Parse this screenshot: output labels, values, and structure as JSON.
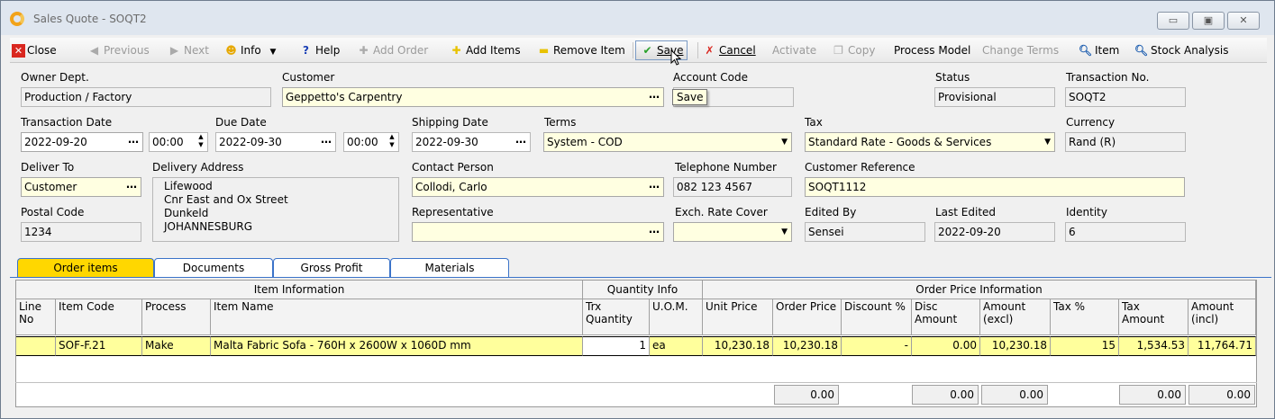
{
  "window": {
    "title": "Sales Quote - SOQT2",
    "minimize": "▭",
    "maximize": "▣",
    "close": "✕"
  },
  "toolbar": {
    "close": "Close",
    "previous": "Previous",
    "next": "Next",
    "info": "Info",
    "help": "Help",
    "add_order": "Add Order",
    "add_items": "Add Items",
    "remove_item": "Remove Item",
    "save": "Save",
    "cancel": "Cancel",
    "activate": "Activate",
    "copy": "Copy",
    "process_model": "Process Model",
    "change_terms": "Change Terms",
    "item": "Item",
    "stock_analysis": "Stock Analysis"
  },
  "tooltip": "Save",
  "form": {
    "owner_dept": {
      "label": "Owner Dept.",
      "value": "Production / Factory"
    },
    "customer": {
      "label": "Customer",
      "value": "Geppetto's Carpentry"
    },
    "account_code": {
      "label": "Account Code",
      "value": ""
    },
    "status": {
      "label": "Status",
      "value": "Provisional"
    },
    "transaction_no": {
      "label": "Transaction No.",
      "value": "SOQT2"
    },
    "transaction_date": {
      "label": "Transaction Date",
      "value": "2022-09-20",
      "time": "00:00"
    },
    "due_date": {
      "label": "Due Date",
      "value": "2022-09-30",
      "time": "00:00"
    },
    "shipping_date": {
      "label": "Shipping Date",
      "value": "2022-09-30"
    },
    "terms": {
      "label": "Terms",
      "value": "System - COD"
    },
    "tax": {
      "label": "Tax",
      "value": "Standard Rate - Goods & Services"
    },
    "currency": {
      "label": "Currency",
      "value": "Rand (R)"
    },
    "deliver_to": {
      "label": "Deliver To",
      "value": "Customer"
    },
    "delivery_address": {
      "label": "Delivery Address",
      "lines": [
        "Lifewood",
        "Cnr East and Ox Street",
        "Dunkeld",
        "JOHANNESBURG"
      ]
    },
    "contact_person": {
      "label": "Contact Person",
      "value": "Collodi, Carlo"
    },
    "telephone": {
      "label": "Telephone Number",
      "value": "082 123 4567"
    },
    "customer_reference": {
      "label": "Customer Reference",
      "value": "SOQT1112"
    },
    "postal_code": {
      "label": "Postal Code",
      "value": "1234"
    },
    "representative": {
      "label": "Representative",
      "value": ""
    },
    "exch_rate_cover": {
      "label": "Exch. Rate Cover",
      "value": ""
    },
    "edited_by": {
      "label": "Edited By",
      "value": "Sensei"
    },
    "last_edited": {
      "label": "Last Edited",
      "value": "2022-09-20"
    },
    "identity": {
      "label": "Identity",
      "value": "6"
    }
  },
  "tabs": [
    "Order items",
    "Documents",
    "Gross Profit",
    "Materials"
  ],
  "grid": {
    "groups": {
      "item_info": "Item Information",
      "qty_info": "Quantity Info",
      "price_info": "Order Price Information"
    },
    "columns": {
      "line_no": "Line\nNo",
      "item_code": "Item Code",
      "process": "Process",
      "item_name": "Item Name",
      "trx_qty": "Trx\nQuantity",
      "uom": "U.O.M.",
      "unit_price": "Unit Price",
      "order_price": "Order Price",
      "discount_pct": "Discount %",
      "disc_amount": "Disc\nAmount",
      "amount_excl": "Amount\n(excl)",
      "tax_pct": "Tax %",
      "tax_amount": "Tax\nAmount",
      "amount_incl": "Amount\n(incl)"
    },
    "rows": [
      {
        "line_no": "",
        "item_code": "SOF-F.21",
        "process": "Make",
        "item_name": "Malta Fabric Sofa - 760H x 2600W x 1060D mm",
        "trx_qty": "1",
        "uom": "ea",
        "unit_price": "10,230.18",
        "order_price": "10,230.18",
        "discount_pct": "-",
        "disc_amount": "0.00",
        "amount_excl": "10,230.18",
        "tax_pct": "15",
        "tax_amount": "1,534.53",
        "amount_incl": "11,764.71"
      }
    ],
    "totals": {
      "order_price": "0.00",
      "disc_amount": "0.00",
      "amount_excl": "0.00",
      "tax_amount": "0.00",
      "amount_incl": "0.00"
    }
  },
  "colors": {
    "active_tab": "#ffd700",
    "selected_row": "#ffff9c",
    "editable_field": "#ffffe1",
    "tab_border": "#3b73c9"
  }
}
